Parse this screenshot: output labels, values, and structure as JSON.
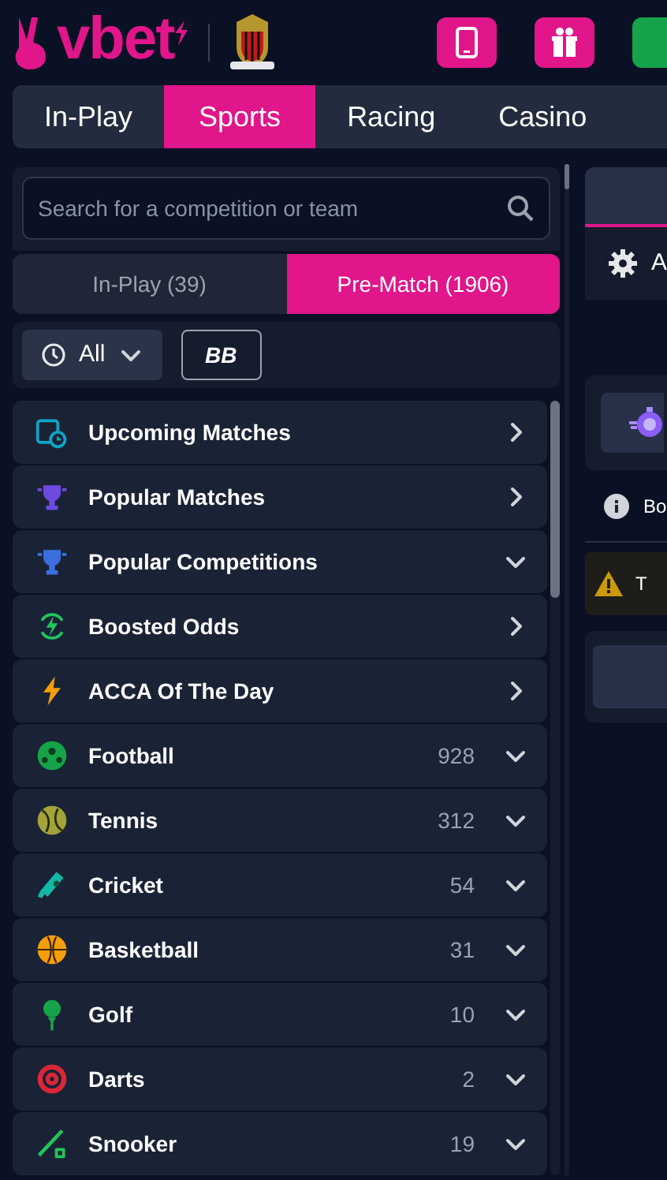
{
  "logo": {
    "text": "vbet"
  },
  "nav_tabs": [
    {
      "label": "In-Play",
      "selected": false
    },
    {
      "label": "Sports",
      "selected": true
    },
    {
      "label": "Racing",
      "selected": false
    },
    {
      "label": "Casino",
      "selected": false
    }
  ],
  "search": {
    "placeholder": "Search for a competition or team"
  },
  "mode_tabs": [
    {
      "label": "In-Play (39)",
      "selected": false
    },
    {
      "label": "Pre-Match (1906)",
      "selected": true
    }
  ],
  "filters": {
    "time": "All",
    "builder": "BB"
  },
  "sports": [
    {
      "name": "Upcoming Matches",
      "kind": "link"
    },
    {
      "name": "Popular Matches",
      "kind": "link"
    },
    {
      "name": "Popular Competitions",
      "kind": "group"
    },
    {
      "name": "Boosted Odds",
      "kind": "link"
    },
    {
      "name": "ACCA Of The Day",
      "kind": "link"
    },
    {
      "name": "Football",
      "kind": "group",
      "count": "928"
    },
    {
      "name": "Tennis",
      "kind": "group",
      "count": "312"
    },
    {
      "name": "Cricket",
      "kind": "group",
      "count": "54"
    },
    {
      "name": "Basketball",
      "kind": "group",
      "count": "31"
    },
    {
      "name": "Golf",
      "kind": "group",
      "count": "10"
    },
    {
      "name": "Darts",
      "kind": "group",
      "count": "2"
    },
    {
      "name": "Snooker",
      "kind": "group",
      "count": "19"
    }
  ],
  "right_panel": {
    "settings_label": "A",
    "info_text": "Bo",
    "warning_text": "T"
  }
}
